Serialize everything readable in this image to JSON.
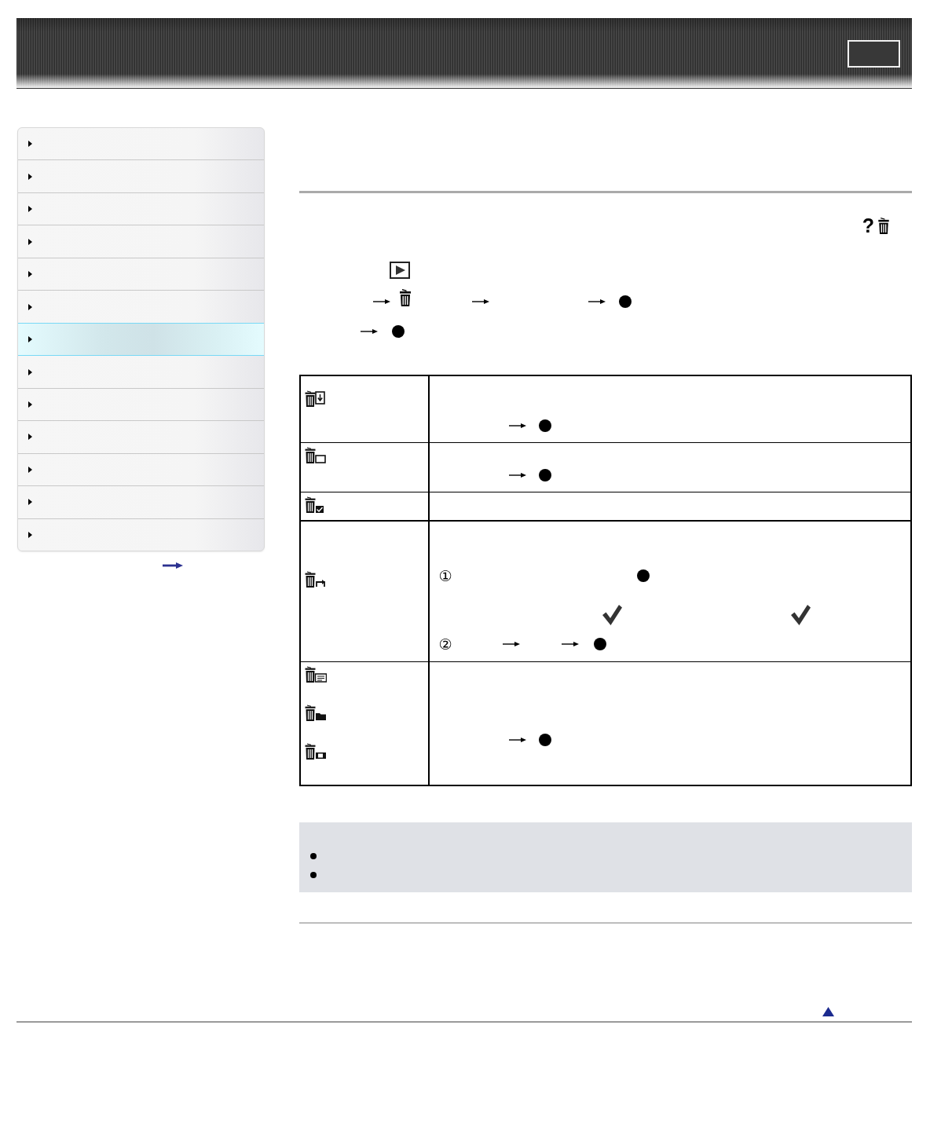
{
  "sidebar": {
    "items": [
      {
        "selected": false
      },
      {
        "selected": false
      },
      {
        "selected": false
      },
      {
        "selected": false
      },
      {
        "selected": false
      },
      {
        "selected": false
      },
      {
        "selected": true
      },
      {
        "selected": false
      },
      {
        "selected": false
      },
      {
        "selected": false
      },
      {
        "selected": false
      },
      {
        "selected": false
      },
      {
        "selected": false
      }
    ]
  },
  "intro": {
    "icon_label": "?"
  },
  "table": {
    "step_numbers": [
      "①",
      "②"
    ]
  }
}
